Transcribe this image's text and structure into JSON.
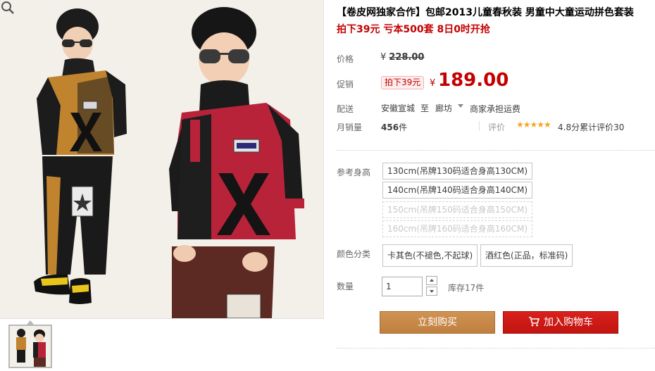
{
  "product": {
    "title": "【卷皮网独家合作】包邮2013儿童春秋装 男童中大童运动拼色套装",
    "subtitle": "拍下39元 亏本500套 8日0时开抢"
  },
  "price": {
    "label": "价格",
    "currency": "¥",
    "original": "228.00"
  },
  "promo": {
    "label": "促销",
    "tag": "拍下39元",
    "currency": "¥",
    "price": "189.00"
  },
  "shipping": {
    "label": "配送",
    "from": "安徽宣城",
    "to_word": "至",
    "destination": "廊坊",
    "fee": "商家承担运费"
  },
  "sales": {
    "label": "月销量",
    "count": "456",
    "unit": "件",
    "rating_label": "评价",
    "stars": "★★★★★",
    "rating_text": "4.8分累计评价30"
  },
  "size": {
    "label": "参考身高",
    "options": [
      {
        "text": "130cm(吊牌130码适合身高130CM)",
        "available": true
      },
      {
        "text": "140cm(吊牌140码适合身高140CM)",
        "available": true
      },
      {
        "text": "150cm(吊牌150码适合身高150CM)",
        "available": false
      },
      {
        "text": "160cm(吊牌160码适合身高160CM)",
        "available": false
      }
    ]
  },
  "color": {
    "label": "颜色分类",
    "options": [
      "卡其色(不褪色,不起球)",
      "酒红色(正品，标准码)"
    ]
  },
  "quantity": {
    "label": "数量",
    "value": "1",
    "stock": "库存17件"
  },
  "actions": {
    "buy_now": "立刻购买",
    "add_to_cart": "加入购物车"
  },
  "colors": {
    "accent_red": "#c40000",
    "buy_button": "#c8894c",
    "cart_button": "#d11b17",
    "star": "#f5a623"
  }
}
